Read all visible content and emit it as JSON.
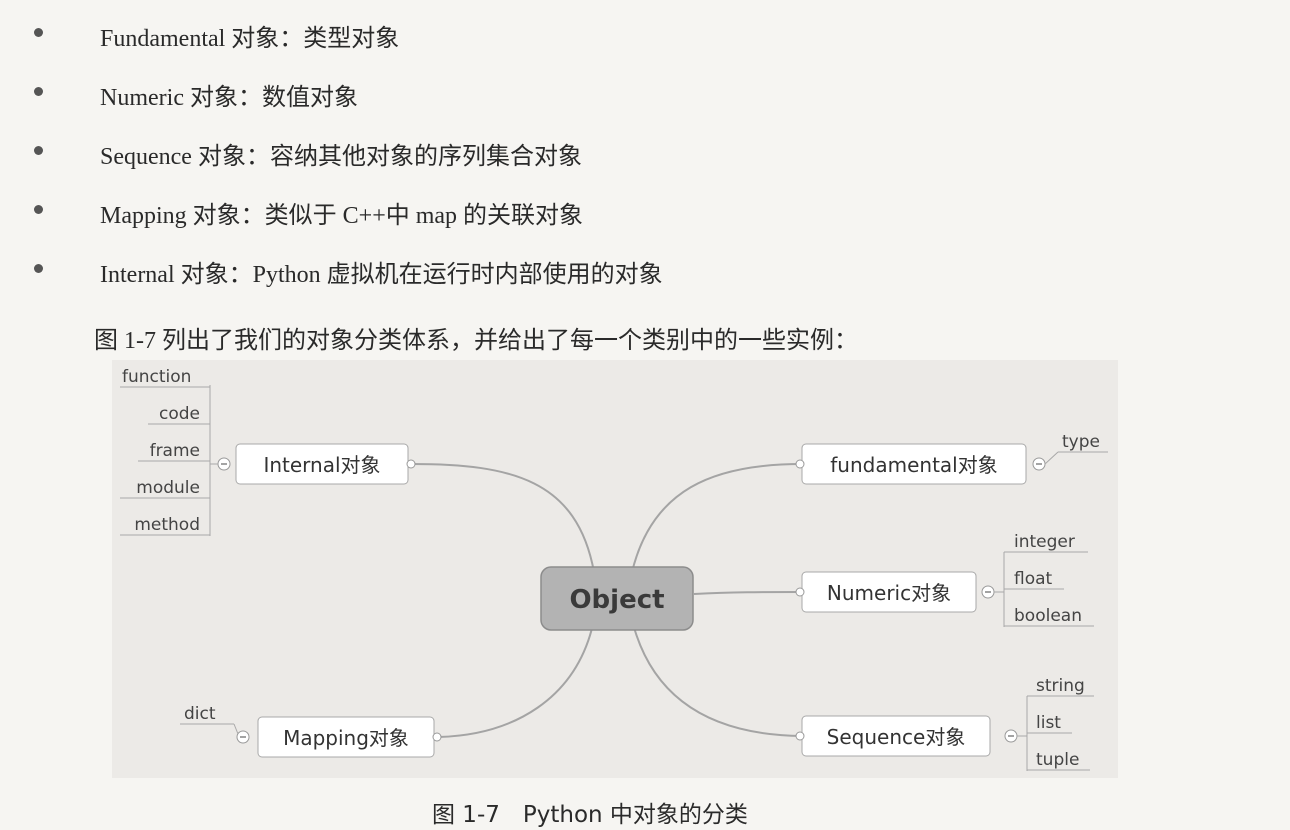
{
  "bullets": [
    "Fundamental 对象：类型对象",
    "Numeric 对象：数值对象",
    "Sequence 对象：容纳其他对象的序列集合对象",
    "Mapping 对象：类似于 C++中 map 的关联对象",
    "Internal 对象：Python 虚拟机在运行时内部使用的对象"
  ],
  "intro": "图 1-7 列出了我们的对象分类体系，并给出了每一个类别中的一些实例：",
  "diagram": {
    "root": "Object",
    "internal": {
      "label": "Internal对象",
      "leaves": [
        "function",
        "code",
        "frame",
        "module",
        "method"
      ]
    },
    "mapping": {
      "label": "Mapping对象",
      "leaves": [
        "dict"
      ]
    },
    "fundamental": {
      "label": "fundamental对象",
      "leaves": [
        "type"
      ]
    },
    "numeric": {
      "label": "Numeric对象",
      "leaves": [
        "integer",
        "float",
        "boolean"
      ]
    },
    "sequence": {
      "label": "Sequence对象",
      "leaves": [
        "string",
        "list",
        "tuple"
      ]
    }
  },
  "caption": "图 1-7　Python 中对象的分类"
}
